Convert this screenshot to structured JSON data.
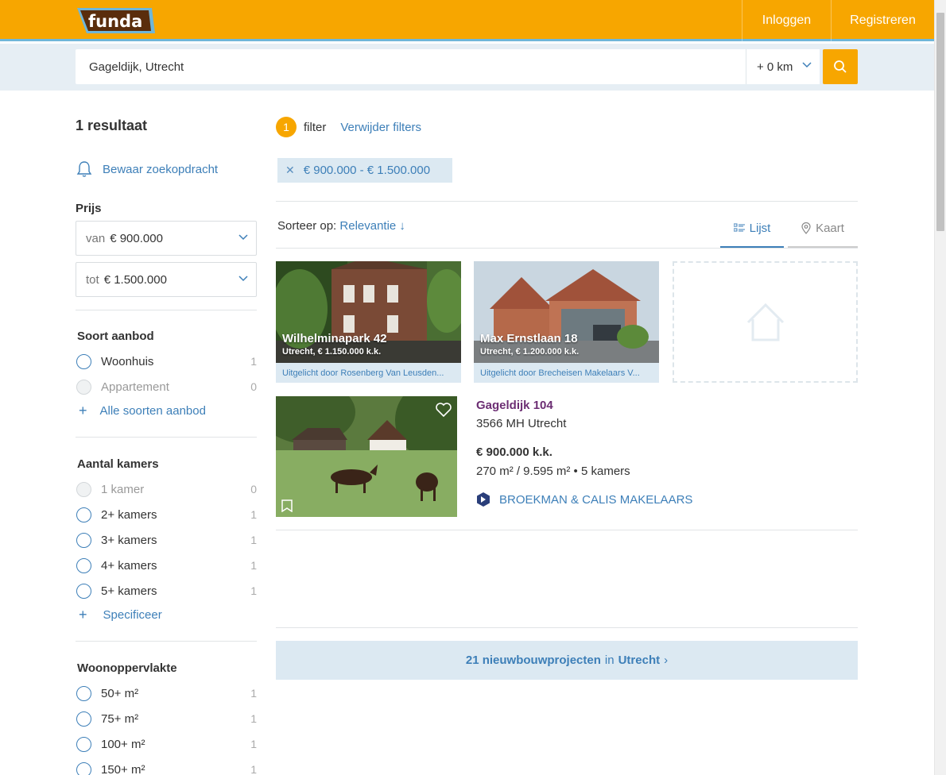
{
  "header": {
    "logo_text": "funda",
    "login_label": "Inloggen",
    "register_label": "Registreren"
  },
  "search": {
    "query": "Gageldijk, Utrecht",
    "radius": "+ 0 km"
  },
  "sidebar": {
    "result_count": "1 resultaat",
    "save_search": "Bewaar zoekopdracht",
    "price": {
      "title": "Prijs",
      "from_prefix": "van",
      "from_value": "€ 900.000",
      "to_prefix": "tot",
      "to_value": "€ 1.500.000"
    },
    "offer_type": {
      "title": "Soort aanbod",
      "options": [
        {
          "label": "Woonhuis",
          "count": "1"
        },
        {
          "label": "Appartement",
          "count": "0"
        }
      ],
      "more": "Alle soorten aanbod"
    },
    "rooms": {
      "title": "Aantal kamers",
      "options": [
        {
          "label": "1 kamer",
          "count": "0"
        },
        {
          "label": "2+ kamers",
          "count": "1"
        },
        {
          "label": "3+ kamers",
          "count": "1"
        },
        {
          "label": "4+ kamers",
          "count": "1"
        },
        {
          "label": "5+ kamers",
          "count": "1"
        }
      ],
      "more": "Specificeer"
    },
    "living_area": {
      "title": "Woonoppervlakte",
      "options": [
        {
          "label": "50+ m²",
          "count": "1"
        },
        {
          "label": "75+ m²",
          "count": "1"
        },
        {
          "label": "100+ m²",
          "count": "1"
        },
        {
          "label": "150+ m²",
          "count": "1"
        }
      ]
    }
  },
  "filters": {
    "count": "1",
    "label": "filter",
    "remove_label": "Verwijder filters",
    "chips": [
      {
        "label": "€ 900.000 - € 1.500.000"
      }
    ]
  },
  "sort": {
    "label": "Sorteer op:",
    "value": "Relevantie ↓"
  },
  "views": {
    "list_label": "Lijst",
    "map_label": "Kaart"
  },
  "featured": [
    {
      "title": "Wilhelminapark 42",
      "subtitle": "Utrecht, € 1.150.000 k.k.",
      "caption": "Uitgelicht door Rosenberg Van Leusden..."
    },
    {
      "title": "Max Ernstlaan 18",
      "subtitle": "Utrecht, € 1.200.000 k.k.",
      "caption": "Uitgelicht door Brecheisen Makelaars V..."
    }
  ],
  "listing": {
    "title": "Gageldijk 104",
    "postal": "3566 MH Utrecht",
    "price": "€ 900.000 k.k.",
    "area": "270 m² / 9.595 m² • 5 kamers",
    "agent": "BROEKMAN & CALIS MAKELAARS"
  },
  "newbuild": {
    "count_label": "21 nieuwbouwprojecten",
    "in": "in",
    "city": "Utrecht",
    "chevron": "›"
  },
  "colors": {
    "brand_orange": "#f7a600",
    "link_blue": "#3d7fb8",
    "listing_title_purple": "#6c2e73",
    "search_bar_bg": "#e6eef4"
  }
}
